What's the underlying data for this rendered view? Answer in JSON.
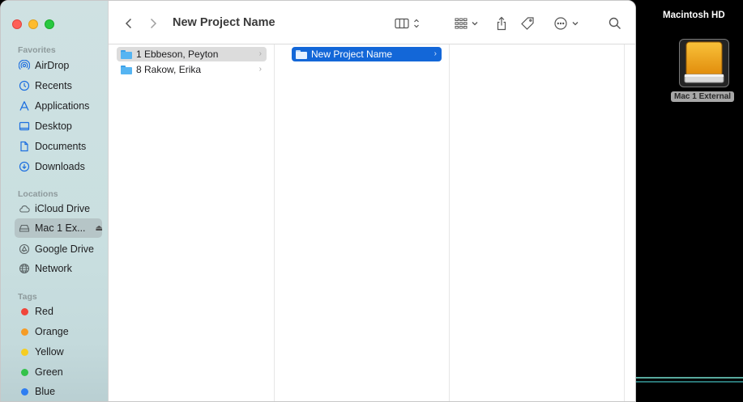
{
  "window": {
    "title": "New Project Name"
  },
  "sidebar": {
    "favorites_title": "Favorites",
    "favorites": [
      {
        "label": "AirDrop",
        "icon": "airdrop-icon"
      },
      {
        "label": "Recents",
        "icon": "clock-icon"
      },
      {
        "label": "Applications",
        "icon": "applications-icon"
      },
      {
        "label": "Desktop",
        "icon": "desktop-icon"
      },
      {
        "label": "Documents",
        "icon": "document-icon"
      },
      {
        "label": "Downloads",
        "icon": "download-icon"
      }
    ],
    "locations_title": "Locations",
    "locations": [
      {
        "label": "iCloud Drive",
        "icon": "cloud-icon"
      },
      {
        "label": "Mac 1 Ex...",
        "icon": "external-drive-icon",
        "selected": true
      },
      {
        "label": "Google Drive",
        "icon": "google-drive-icon"
      },
      {
        "label": "Network",
        "icon": "network-icon"
      }
    ],
    "tags_title": "Tags",
    "tags": [
      {
        "label": "Red",
        "color": "#f0453a"
      },
      {
        "label": "Orange",
        "color": "#f59c26"
      },
      {
        "label": "Yellow",
        "color": "#f5cd22"
      },
      {
        "label": "Green",
        "color": "#33c24a"
      },
      {
        "label": "Blue",
        "color": "#2f7ef2"
      }
    ]
  },
  "columns": {
    "col1": [
      {
        "label": "1 Ebbeson, Peyton",
        "selected": true
      },
      {
        "label": "8 Rakow, Erika",
        "selected": false
      }
    ],
    "col2": [
      {
        "label": "New Project Name",
        "selected": true
      }
    ]
  },
  "desktop": {
    "title": "Macintosh HD",
    "drive_label": "Mac 1 External",
    "drive_color": "#f0a315"
  }
}
